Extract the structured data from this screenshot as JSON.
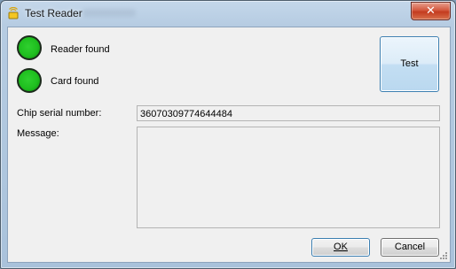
{
  "window": {
    "title": "Test Reader",
    "close_label": "✕"
  },
  "status": {
    "reader_label": "Reader found",
    "card_label": "Card found",
    "reader_color": "#22c422",
    "card_color": "#22c422"
  },
  "test_button": {
    "label": "Test"
  },
  "serial": {
    "label": "Chip serial number:",
    "value": "36070309774644484"
  },
  "message": {
    "label": "Message:",
    "value": ""
  },
  "buttons": {
    "ok_label": "OK",
    "cancel_label": "Cancel"
  }
}
